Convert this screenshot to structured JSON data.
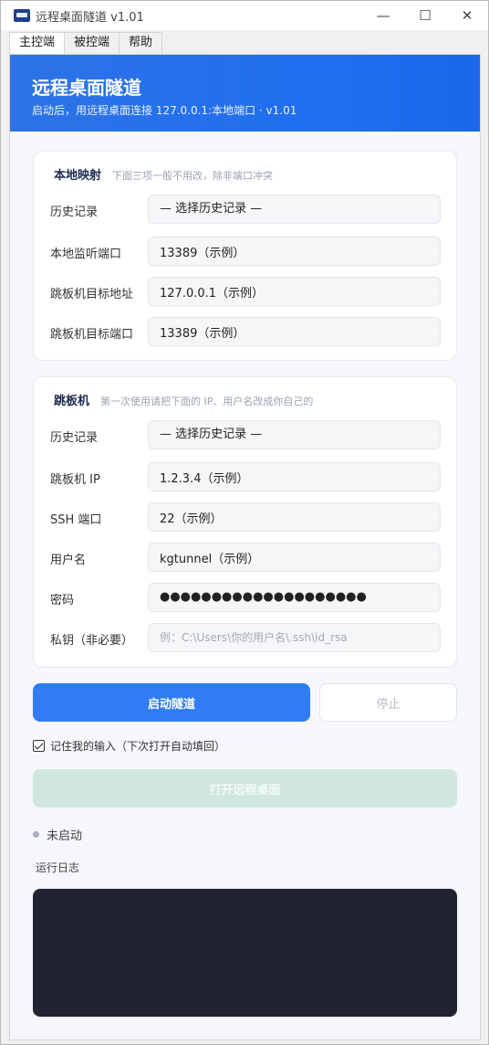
{
  "window": {
    "title": "远程桌面隧道 v1.01",
    "icon": "kg-app-icon",
    "controls": {
      "minimize": "—",
      "maximize": "☐",
      "close": "✕"
    }
  },
  "tabs": [
    {
      "label": "主控端",
      "active": true
    },
    {
      "label": "被控端",
      "active": false
    },
    {
      "label": "帮助",
      "active": false
    }
  ],
  "header": {
    "title": "远程桌面隧道",
    "subtitle": "启动后，用远程桌面连接 127.0.0.1:本地端口 · v1.01"
  },
  "local": {
    "title": "本地映射",
    "hint": "下面三项一般不用改，除非端口冲突",
    "history_label": "历史记录",
    "history_value": "— 选择历史记录 —",
    "port_label": "本地监听端口",
    "port_value": "13389（示例）",
    "target_host_label": "跳板机目标地址",
    "target_host_value": "127.0.0.1（示例）",
    "target_port_label": "跳板机目标端口",
    "target_port_value": "13389（示例）"
  },
  "jump": {
    "title": "跳板机",
    "hint": "第一次使用请把下面的 IP、用户名改成你自己的",
    "history_label": "历史记录",
    "history_value": "— 选择历史记录 —",
    "ip_label": "跳板机 IP",
    "ip_value": "1.2.3.4（示例）",
    "ssh_port_label": "SSH 端口",
    "ssh_port_value": "22（示例）",
    "user_label": "用户名",
    "user_value": "kgtunnel（示例）",
    "password_label": "密码",
    "password_value": "●●●●●●●●●●●●●●●●●●●●",
    "key_label": "私钥（非必要）",
    "key_placeholder": "例：C:\\Users\\你的用户名\\.ssh\\id_rsa"
  },
  "actions": {
    "start_label": "启动隧道",
    "stop_label": "停止",
    "remember_label": "记住我的输入（下次打开自动填回）",
    "remember_checked": true,
    "open_rdp_label": "打开远程桌面"
  },
  "status": {
    "text": "未启动"
  },
  "log": {
    "label": "运行日志"
  },
  "colors": {
    "primary": "#2f7cf5",
    "header_gradient_start": "#2d73e6",
    "open_disabled": "#cfe7dd",
    "log_bg": "#1f2430"
  }
}
